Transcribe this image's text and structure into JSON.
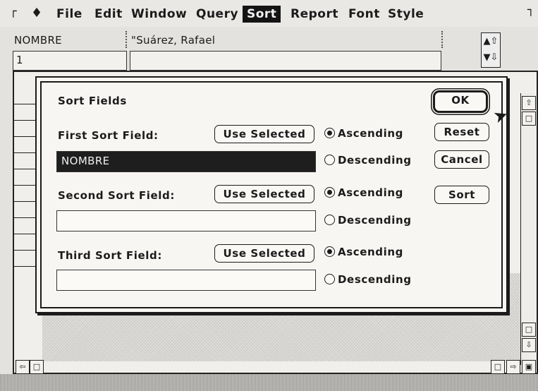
{
  "menubar": {
    "items": [
      "File",
      "Edit",
      "Window",
      "Query",
      "Sort",
      "Report",
      "Font",
      "Style"
    ],
    "active": "Sort"
  },
  "record": {
    "field_name": "NOMBRE",
    "field_value": "\"Suárez, Rafael",
    "record_number": "1"
  },
  "dialog": {
    "title": "Sort Fields",
    "use_selected_label": "Use Selected",
    "ascending_label": "Ascending",
    "descending_label": "Descending",
    "first": {
      "label": "First Sort Field:",
      "value": "NOMBRE",
      "order": "Ascending"
    },
    "second": {
      "label": "Second Sort Field:",
      "value": "",
      "order": "Ascending"
    },
    "third": {
      "label": "Third Sort Field:",
      "value": "",
      "order": "Ascending"
    },
    "buttons": {
      "ok": "OK",
      "reset": "Reset",
      "cancel": "Cancel",
      "sort": "Sort"
    }
  },
  "icons": {
    "apple": "apple-icon",
    "scroll_up": "scroll-up-icon",
    "scroll_down": "scroll-down-icon",
    "cursor": "arrow-cursor-icon"
  }
}
